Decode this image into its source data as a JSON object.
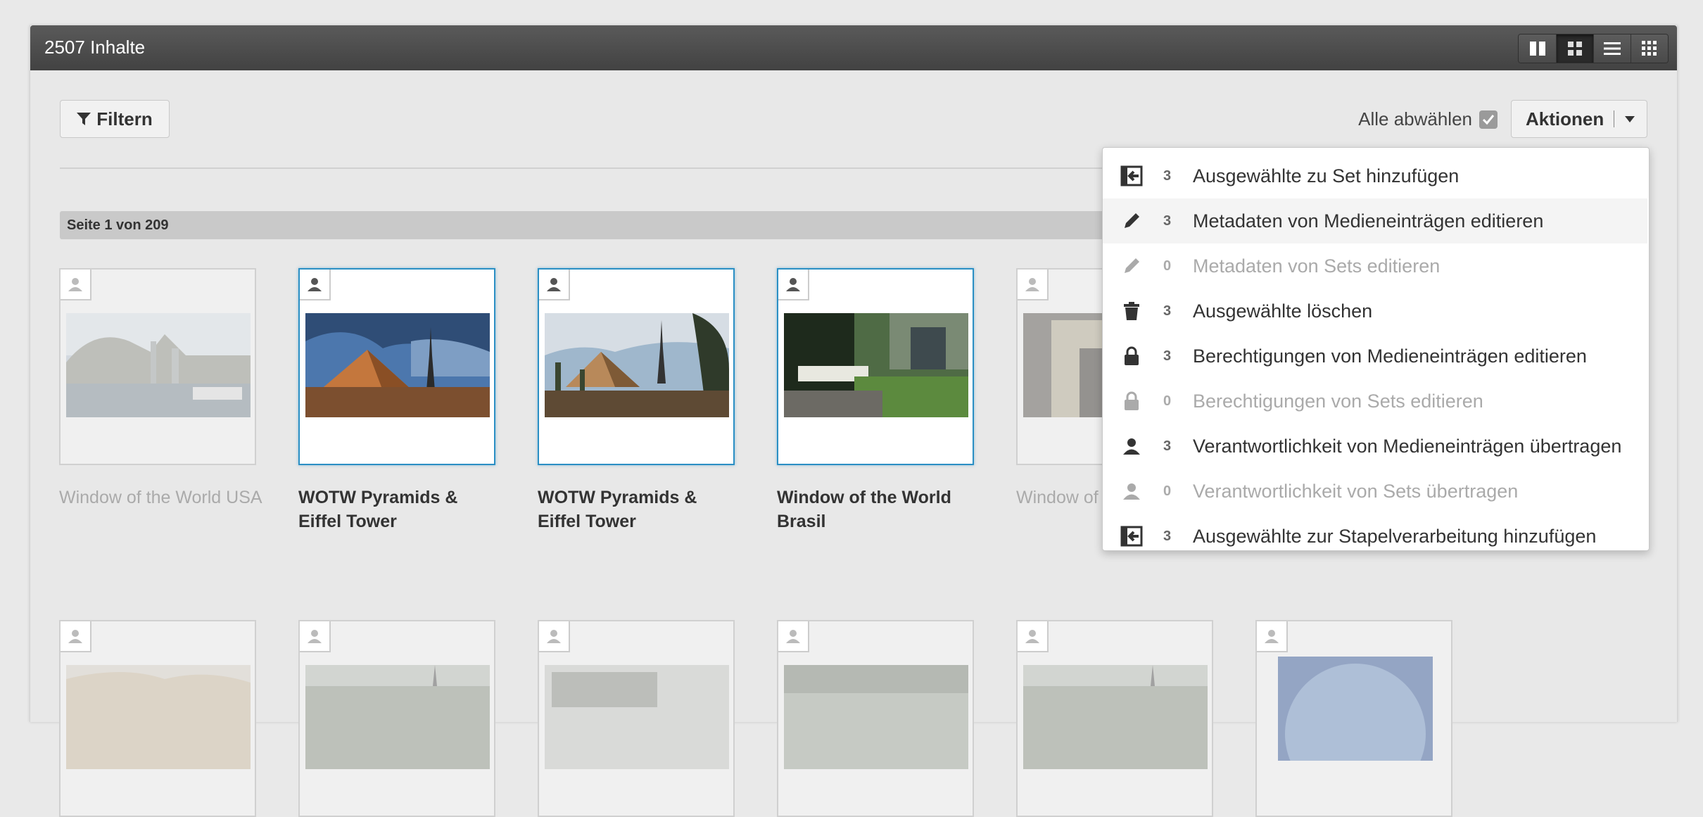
{
  "header": {
    "title": "2507 Inhalte",
    "view_modes": [
      {
        "icon": "columns-view-icon"
      },
      {
        "icon": "grid-view-icon",
        "active": true
      },
      {
        "icon": "list-view-icon"
      },
      {
        "icon": "tiles-view-icon"
      }
    ]
  },
  "toolbar": {
    "filter_label": "Filtern",
    "deselect_label": "Alle abwählen",
    "actions_label": "Aktionen"
  },
  "pagination": {
    "label": "Seite 1 von 209"
  },
  "grid": {
    "row1": [
      {
        "caption": "Window of the World USA",
        "selected": false
      },
      {
        "caption": "WOTW Pyramids & Eiffel Tower",
        "selected": true
      },
      {
        "caption": "WOTW Pyramids & Eiffel Tower",
        "selected": true
      },
      {
        "caption": "Window of the World Brasil",
        "selected": true
      },
      {
        "caption": "Window of",
        "selected": false
      }
    ]
  },
  "actions_menu": [
    {
      "icon": "add-to-set-icon",
      "count": "3",
      "label": "Ausgewählte zu Set hinzufügen",
      "enabled": true
    },
    {
      "icon": "pencil-icon",
      "count": "3",
      "label": "Metadaten von Medieneinträgen editieren",
      "enabled": true
    },
    {
      "icon": "pencil-icon",
      "count": "0",
      "label": "Metadaten von Sets editieren",
      "enabled": false
    },
    {
      "icon": "trash-icon",
      "count": "3",
      "label": "Ausgewählte löschen",
      "enabled": true
    },
    {
      "icon": "lock-icon",
      "count": "3",
      "label": "Berechtigungen von Medieneinträgen editieren",
      "enabled": true
    },
    {
      "icon": "lock-icon",
      "count": "0",
      "label": "Berechtigungen von Sets editieren",
      "enabled": false
    },
    {
      "icon": "user-icon",
      "count": "3",
      "label": "Verantwortlichkeit von Medieneinträgen übertragen",
      "enabled": true
    },
    {
      "icon": "user-icon",
      "count": "0",
      "label": "Verantwortlichkeit von Sets übertragen",
      "enabled": false
    },
    {
      "icon": "add-to-batch-icon",
      "count": "3",
      "label": "Ausgewählte zur Stapelverarbeitung hinzufügen",
      "enabled": true
    }
  ]
}
